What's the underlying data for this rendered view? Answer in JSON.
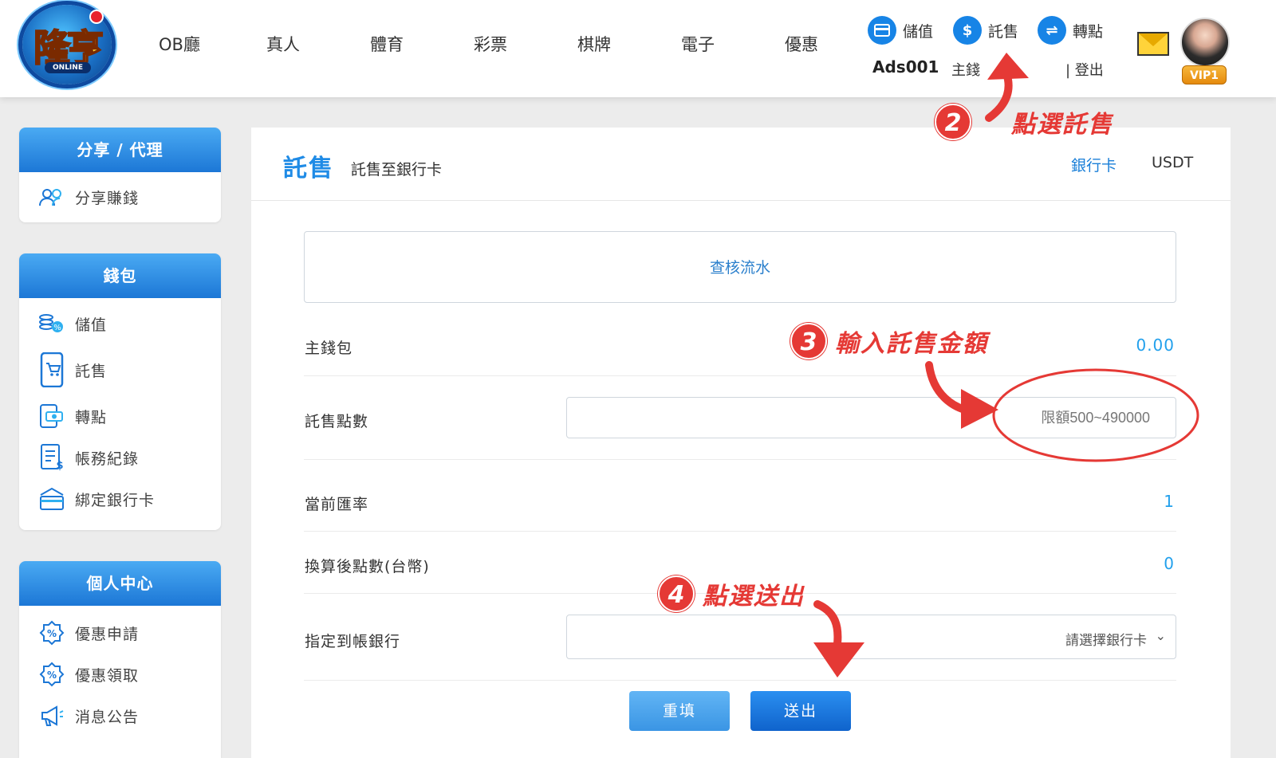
{
  "header": {
    "logo_text": "隆亨",
    "logo_sub": "ONLINE",
    "nav": [
      "OB廳",
      "真人",
      "體育",
      "彩票",
      "棋牌",
      "電子",
      "優惠"
    ],
    "actions": {
      "deposit": "儲值",
      "withdraw": "託售",
      "transfer": "轉點"
    },
    "username": "Ads001",
    "main_wallet_label": "主錢",
    "logout": "| 登出",
    "vip": "VIP1"
  },
  "sidebar": {
    "share": {
      "title": "分享 / 代理",
      "items": [
        {
          "label": "分享賺錢",
          "icon": "users-icon"
        }
      ]
    },
    "wallet": {
      "title": "錢包",
      "items": [
        {
          "label": "儲值",
          "icon": "coins-icon"
        },
        {
          "label": "託售",
          "icon": "mobile-cart-icon"
        },
        {
          "label": "轉點",
          "icon": "transfer-money-icon"
        },
        {
          "label": "帳務紀錄",
          "icon": "ledger-icon"
        },
        {
          "label": "綁定銀行卡",
          "icon": "bank-card-icon"
        }
      ]
    },
    "personal": {
      "title": "個人中心",
      "items": [
        {
          "label": "優惠申請",
          "icon": "percent-badge-icon"
        },
        {
          "label": "優惠領取",
          "icon": "percent-badge-icon"
        },
        {
          "label": "消息公告",
          "icon": "megaphone-icon"
        }
      ]
    }
  },
  "panel": {
    "title": "託售",
    "subtitle": "託售至銀行卡",
    "tabs": [
      "銀行卡",
      "USDT"
    ],
    "audit_label": "查核流水",
    "rows": {
      "main_wallet": {
        "label": "主錢包",
        "value": "0.00"
      },
      "sell_points": {
        "label": "託售點數",
        "placeholder": "限額500~490000"
      },
      "rate": {
        "label": "當前匯率",
        "value": "1"
      },
      "converted": {
        "label": "換算後點數(台幣)",
        "value": "0"
      },
      "bank": {
        "label": "指定到帳銀行",
        "placeholder": "請選擇銀行卡"
      }
    },
    "buttons": {
      "reset": "重填",
      "submit": "送出"
    }
  },
  "annotations": {
    "step2": {
      "num": "2",
      "text": "點選託售"
    },
    "step3": {
      "num": "3",
      "text": "輸入託售金額"
    },
    "step4": {
      "num": "4",
      "text": "點選送出"
    }
  },
  "colors": {
    "accent": "#1c77d6",
    "annotation": "#e53935",
    "value": "#22a0ec"
  }
}
